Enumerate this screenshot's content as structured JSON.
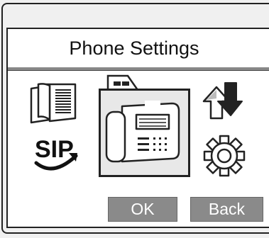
{
  "header": {
    "title": "Phone Settings"
  },
  "menu": {
    "items": [
      {
        "id": "directory",
        "icon": "book-icon"
      },
      {
        "id": "sip",
        "icon": "sip-logo-icon",
        "label": "SIP"
      },
      {
        "id": "phone-settings",
        "icon": "desk-phone-icon",
        "selected": true
      },
      {
        "id": "transfer",
        "icon": "up-down-arrows-icon"
      },
      {
        "id": "settings",
        "icon": "gear-icon"
      }
    ]
  },
  "softkeys": {
    "ok_label": "OK",
    "back_label": "Back"
  },
  "colors": {
    "background": "#f0f0f0",
    "panel": "#ffffff",
    "softkey": "#8a8a8a",
    "selected_tile": "#e8e8e8",
    "stroke": "#222222"
  }
}
